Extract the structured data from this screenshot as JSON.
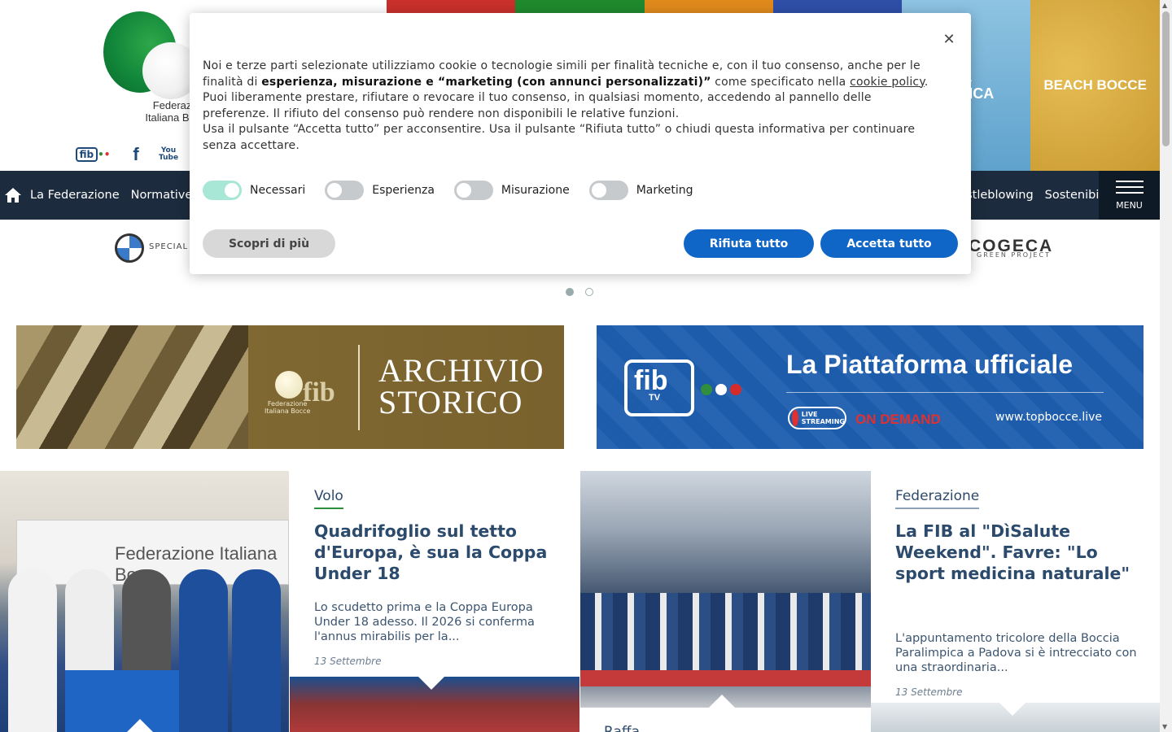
{
  "header": {
    "logo_text": "Federazione\nItaliana Bocce",
    "socials": [
      {
        "name": "fibtv",
        "label": "fib"
      },
      {
        "name": "facebook",
        "label": "f"
      },
      {
        "name": "youtube",
        "label": "You\nTube"
      }
    ]
  },
  "tiles": [
    {
      "label": "",
      "color": "#c9302c"
    },
    {
      "label": "",
      "color": "#1f8a2e"
    },
    {
      "label": "",
      "color": "#e08a1c"
    },
    {
      "label": "",
      "color": "#2f4fa8"
    },
    {
      "label": "CIA\nMPICA",
      "color": "#7cb8dc"
    },
    {
      "label": "BEACH BOCCE",
      "color": "#d8aa3c"
    }
  ],
  "nav": {
    "items_left": [
      "La Federazione",
      "Normative"
    ],
    "items_right": [
      "Whistleblowing",
      "Sostenibilità"
    ],
    "menu_label": "MENU"
  },
  "sponsors": {
    "left_text": "SPECIAL",
    "right_text": "COGECA",
    "right_sub": "GREEN PROJECT"
  },
  "banners": {
    "archive": {
      "fed": "Federazione\nItaliana Bocce",
      "fib": "fib",
      "title": "ARCHIVIO\nSTORICO"
    },
    "tv": {
      "fib": "fib",
      "tv": "TV",
      "headline": "La Piattaforma ufficiale",
      "live": "LIVE STREAMING",
      "ondemand": "ON DEMAND",
      "url": "www.topbocce.live"
    }
  },
  "news": [
    {
      "category": "Volo",
      "title": "Quadrifoglio sul tetto d'Europa, è sua la Coppa Under 18",
      "excerpt": "Lo scudetto prima e la Coppa Europa Under 18 adesso. Il 2026 si conferma l'annus mirabilis per la...",
      "date": "13 Settembre",
      "photo_banner": "Federazione Italiana Bocc"
    },
    {
      "category": "Federazione",
      "title": "La FIB al \"DìSalute Weekend\". Favre: \"Lo sport medicina naturale\"",
      "excerpt": "L'appuntamento tricolore della Boccia Paralimpica a Padova si è intrecciato con una straordinaria...",
      "date": "13 Settembre"
    },
    {
      "category": "Raffa"
    }
  ],
  "cookie": {
    "text_1": "Noi e terze parti selezionate utilizziamo cookie o tecnologie simili per finalità tecniche e, con il tuo consenso, anche per le finalità di ",
    "text_bold": "esperienza, misurazione e “marketing (con annunci personalizzati)”",
    "text_2": " come specificato nella ",
    "link": "cookie policy",
    "text_3": ".",
    "text_4": "Puoi liberamente prestare, rifiutare o revocare il tuo consenso, in qualsiasi momento, accedendo al pannello delle preferenze. Il rifiuto del consenso può rendere non disponibili le relative funzioni.",
    "text_5": "Usa il pulsante “Accetta tutto” per acconsentire. Usa il pulsante “Rifiuta tutto” o chiudi questa informativa per continuare senza accettare.",
    "toggles": [
      {
        "label": "Necessari",
        "on": true
      },
      {
        "label": "Esperienza",
        "on": false
      },
      {
        "label": "Misurazione",
        "on": false
      },
      {
        "label": "Marketing",
        "on": false
      }
    ],
    "learn_more": "Scopri di più",
    "reject_all": "Rifiuta tutto",
    "accept_all": "Accetta tutto",
    "close_icon": "close-icon"
  },
  "colors": {
    "nav_bg": "#1c2b3d",
    "primary_button": "#0f66c6",
    "heading": "#2b4a6c"
  }
}
